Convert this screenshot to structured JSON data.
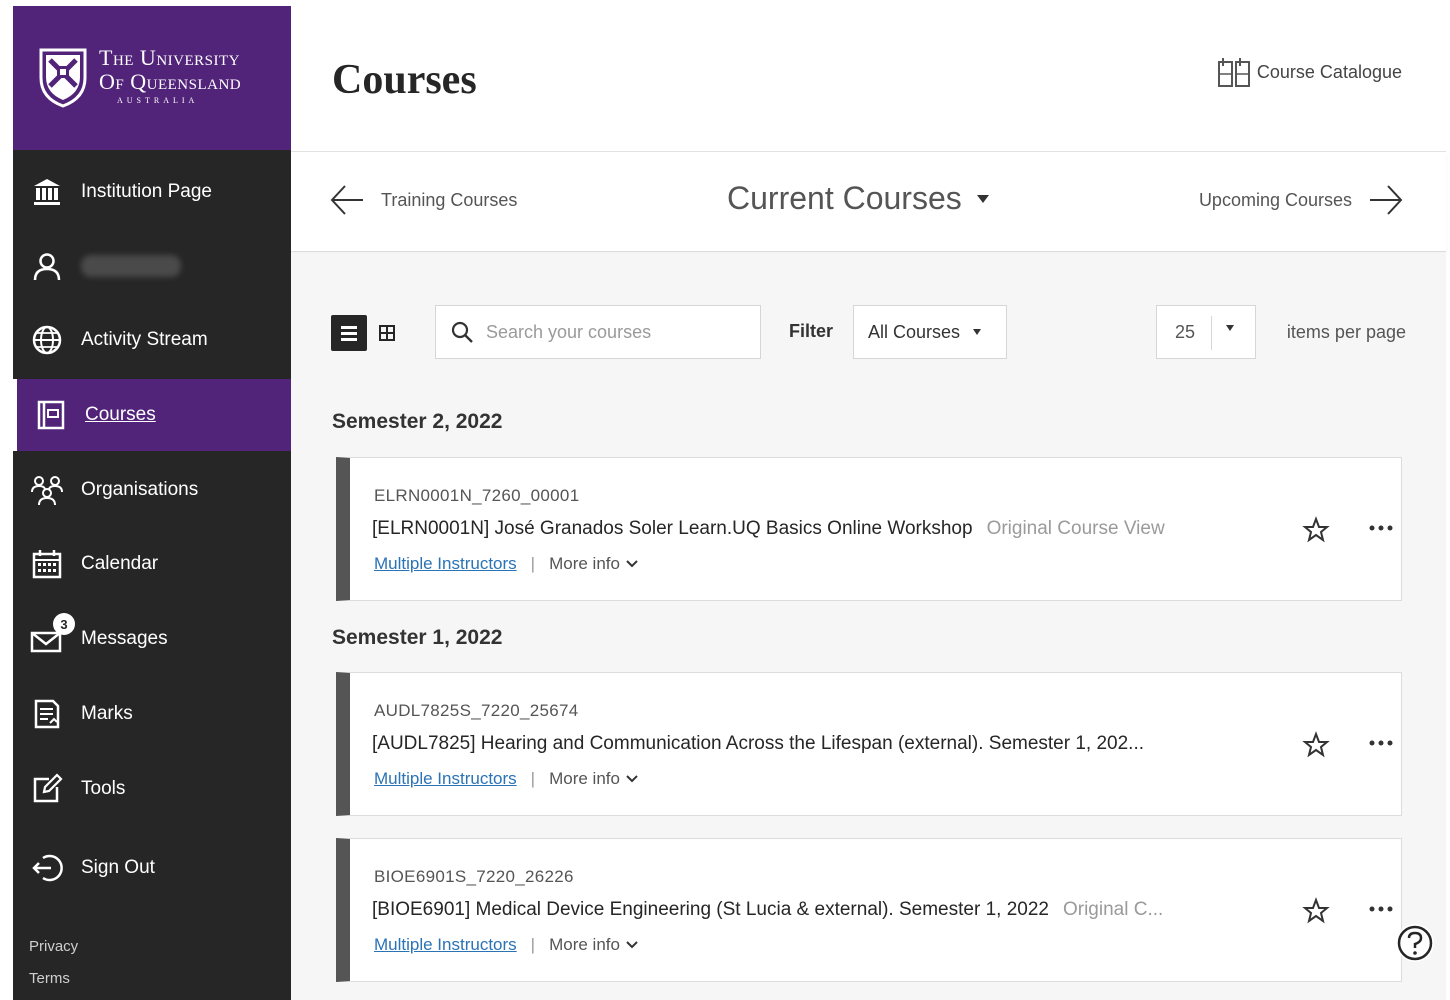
{
  "university": {
    "line1": "The University",
    "line2": "Of Queensland",
    "line3": "AUSTRALIA",
    "brand_color": "#51247a"
  },
  "sidebar": {
    "items": [
      {
        "label": "Institution Page",
        "icon": "institution-icon"
      },
      {
        "label": "",
        "icon": "user-icon"
      },
      {
        "label": "Activity Stream",
        "icon": "globe-icon"
      },
      {
        "label": "Courses",
        "icon": "courses-icon",
        "active": true
      },
      {
        "label": "Organisations",
        "icon": "organisations-icon"
      },
      {
        "label": "Calendar",
        "icon": "calendar-icon"
      },
      {
        "label": "Messages",
        "icon": "messages-icon",
        "badge": "3"
      },
      {
        "label": "Marks",
        "icon": "marks-icon"
      },
      {
        "label": "Tools",
        "icon": "tools-icon"
      },
      {
        "label": "Sign Out",
        "icon": "sign-out-icon"
      }
    ],
    "footer": {
      "privacy": "Privacy",
      "terms": "Terms"
    }
  },
  "header": {
    "title": "Courses",
    "catalogue_label": "Course Catalogue"
  },
  "term_nav": {
    "prev": "Training Courses",
    "current": "Current Courses",
    "next": "Upcoming Courses"
  },
  "toolbar": {
    "search_placeholder": "Search your courses",
    "filter_label": "Filter",
    "filter_value": "All Courses",
    "per_page_value": "25",
    "per_page_label": "items per page"
  },
  "semesters": [
    {
      "name": "Semester 2, 2022",
      "courses": [
        {
          "code": "ELRN0001N_7260_00001",
          "title": "[ELRN0001N] José Granados Soler Learn.UQ Basics Online Workshop",
          "view_tag": "Original Course View",
          "instructors": "Multiple Instructors",
          "more_info": "More info"
        }
      ]
    },
    {
      "name": "Semester 1, 2022",
      "courses": [
        {
          "code": "AUDL7825S_7220_25674",
          "title": "[AUDL7825] Hearing and Communication Across the Lifespan (external). Semester 1, 202...",
          "view_tag": "",
          "instructors": "Multiple Instructors",
          "more_info": "More info"
        },
        {
          "code": "BIOE6901S_7220_26226",
          "title": "[BIOE6901] Medical Device Engineering (St Lucia & external). Semester 1, 2022",
          "view_tag": "Original C...",
          "instructors": "Multiple Instructors",
          "more_info": "More info"
        }
      ]
    }
  ],
  "colors": {
    "sidebar_bg": "#262626",
    "accent": "#51247a",
    "link": "#2a73b5"
  }
}
